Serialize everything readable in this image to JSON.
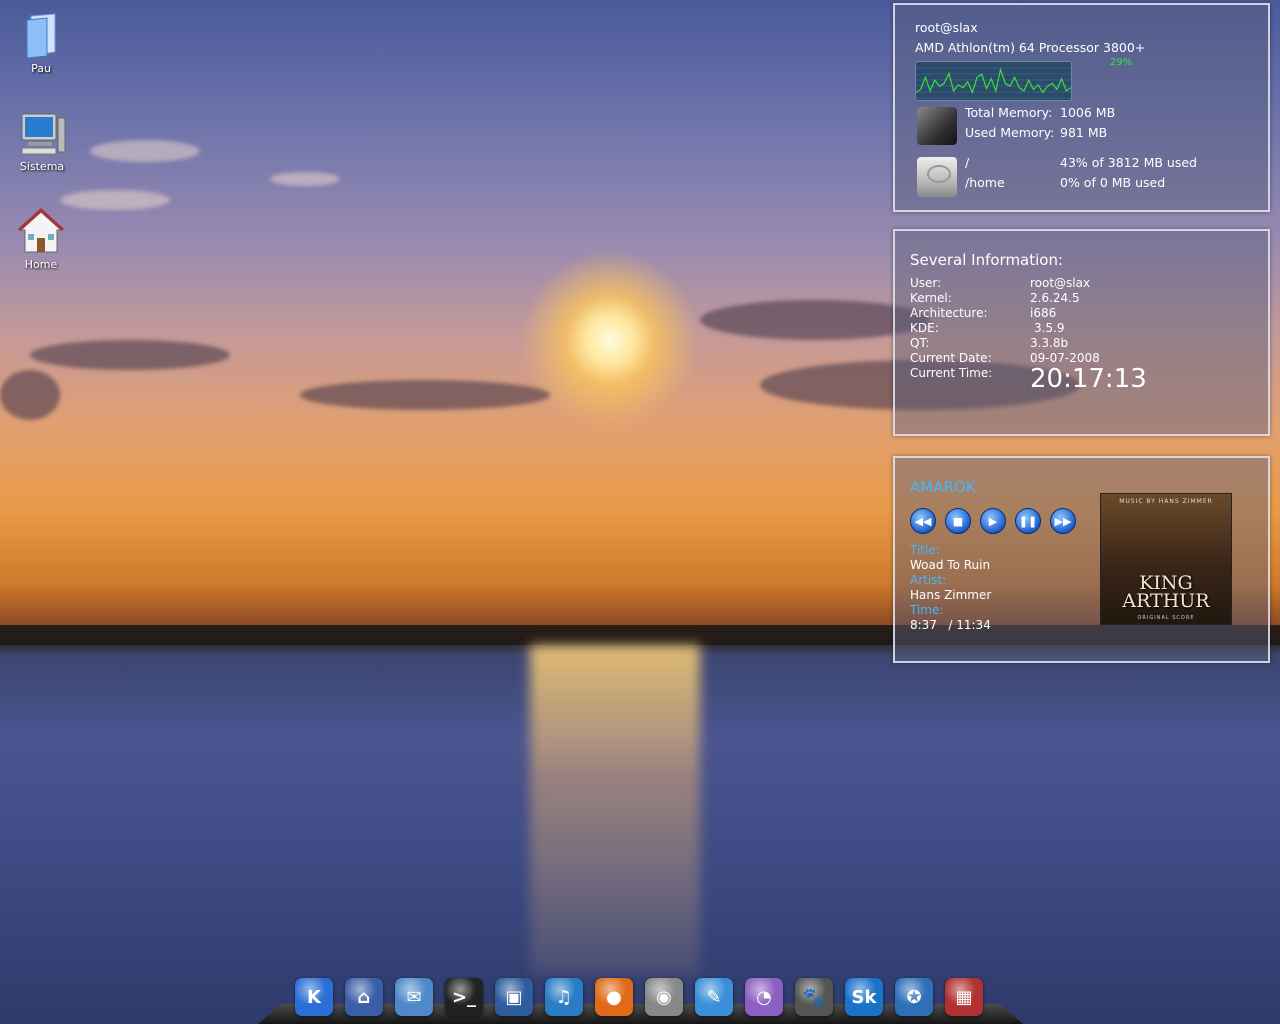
{
  "desktop_icons": [
    {
      "label": "Pau",
      "icon": "folder-icon"
    },
    {
      "label": "Sistema",
      "icon": "computer-icon"
    },
    {
      "label": "Home",
      "icon": "home-icon"
    }
  ],
  "system_monitor": {
    "hostname": "root@slax",
    "cpu_name": "AMD Athlon(tm) 64 Processor 3800+",
    "cpu_percent": "29%",
    "total_memory_label": "Total Memory:",
    "total_memory_value": "1006 MB",
    "used_memory_label": "Used Memory:",
    "used_memory_value": "981 MB",
    "disks": [
      {
        "mount": "/",
        "usage": "43% of 3812 MB used"
      },
      {
        "mount": "/home",
        "usage": "0% of 0 MB used"
      }
    ],
    "cpu_history": [
      10,
      14,
      30,
      12,
      26,
      18,
      22,
      35,
      12,
      20,
      16,
      24,
      10,
      30,
      34,
      15,
      28,
      12,
      40,
      22,
      18,
      30,
      16,
      12,
      26,
      14,
      20,
      10,
      18,
      22,
      14,
      28,
      12,
      16
    ]
  },
  "several_info": {
    "title": "Several Information:",
    "rows": [
      {
        "label": "User:",
        "value": "root@slax"
      },
      {
        "label": "Kernel:",
        "value": "2.6.24.5"
      },
      {
        "label": "Architecture:",
        "value": "i686"
      },
      {
        "label": "KDE:",
        "value": "3.5.9"
      },
      {
        "label": "QT:",
        "value": "3.3.8b"
      },
      {
        "label": "Current Date:",
        "value": "09-07-2008"
      },
      {
        "label": "Current Time:",
        "value": "20:17:13"
      }
    ]
  },
  "amarok": {
    "title": "AMAROK",
    "title_label": "Title:",
    "track_title": "Woad To Ruin",
    "artist_label": "Artist:",
    "artist": "Hans Zimmer",
    "time_label": "Time:",
    "time": "8:37   / 11:34",
    "cover_top": "MUSIC BY HANS ZIMMER",
    "cover_title": "KING ARTHUR",
    "cover_bottom": "ORIGINAL SCORE"
  },
  "dock_items": [
    {
      "name": "kde-menu-icon",
      "glyph": "K",
      "color": "#2b6fd6"
    },
    {
      "name": "home-icon",
      "glyph": "⌂",
      "color": "#3a5fa8"
    },
    {
      "name": "mail-icon",
      "glyph": "✉",
      "color": "#4f89c9"
    },
    {
      "name": "terminal-icon",
      "glyph": ">_",
      "color": "#222"
    },
    {
      "name": "network-icon",
      "glyph": "▣",
      "color": "#2e5d9e"
    },
    {
      "name": "music-icon",
      "glyph": "♫",
      "color": "#2a7cc4"
    },
    {
      "name": "firefox-icon",
      "glyph": "●",
      "color": "#e06a18"
    },
    {
      "name": "media-icon",
      "glyph": "◉",
      "color": "#888"
    },
    {
      "name": "office-writer-icon",
      "glyph": "✎",
      "color": "#3b8fd8"
    },
    {
      "name": "office-impress-icon",
      "glyph": "◔",
      "color": "#8c5fc2"
    },
    {
      "name": "gimp-icon",
      "glyph": "🐾",
      "color": "#555"
    },
    {
      "name": "skype-icon",
      "glyph": "Sk",
      "color": "#1a72c9"
    },
    {
      "name": "globe-icon",
      "glyph": "✪",
      "color": "#2f6fb8"
    },
    {
      "name": "package-icon",
      "glyph": "▦",
      "color": "#b23030"
    }
  ]
}
